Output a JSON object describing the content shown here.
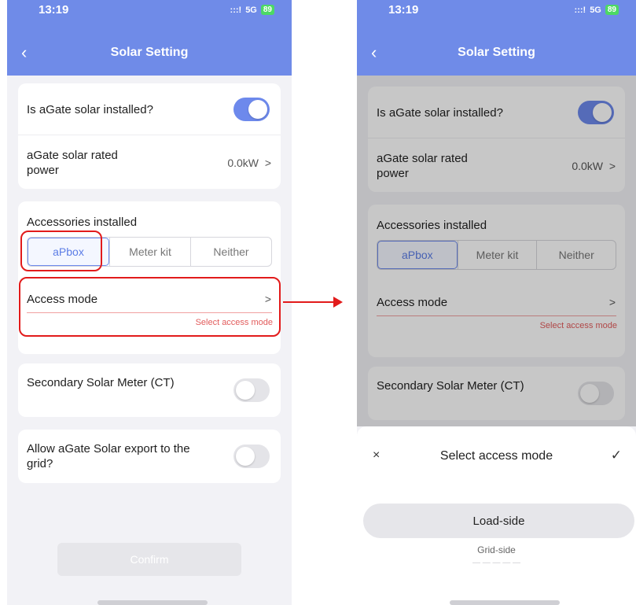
{
  "status": {
    "time": "13:19",
    "signal": ":::!",
    "network": "5G",
    "battery": "89"
  },
  "header": {
    "back_glyph": "‹",
    "title": "Solar Setting"
  },
  "settings": {
    "installed_label": "Is aGate solar installed?",
    "installed_on": true,
    "rated_power_label": "aGate solar rated power",
    "rated_power_value": "0.0kW",
    "chevron": ">",
    "accessories_label": "Accessories installed",
    "accessories_options": [
      "aPbox",
      "Meter kit",
      "Neither"
    ],
    "accessories_selected": "aPbox",
    "access_mode_label": "Access mode",
    "access_mode_hint": "Select access mode",
    "secondary_meter_label": "Secondary Solar Meter (CT)",
    "secondary_meter_on": false,
    "export_label": "Allow aGate Solar export to the grid?",
    "export_on": false,
    "confirm_label": "Confirm"
  },
  "sheet": {
    "close_glyph": "×",
    "title": "Select access mode",
    "check_glyph": "✓",
    "selected": "Load-side",
    "next": "Grid-side"
  },
  "colors": {
    "header": "#6f8be8",
    "accent": "#6d89ec",
    "highlight": "#e21b1b",
    "hint": "#e25c5c"
  }
}
